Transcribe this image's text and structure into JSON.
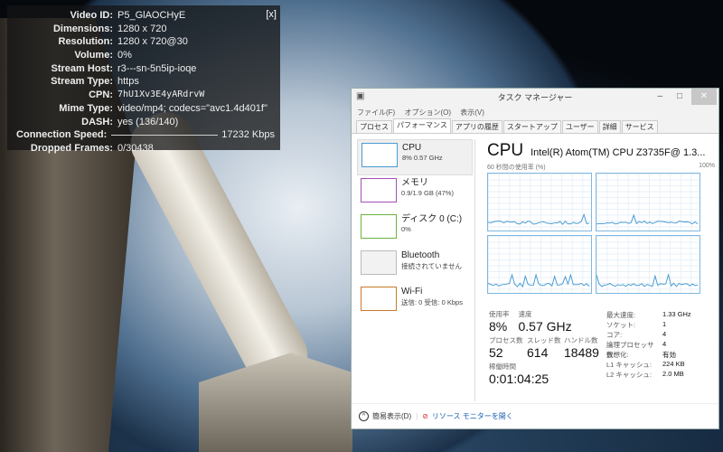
{
  "stats": {
    "close": "[x]",
    "rows": [
      {
        "k": "Video ID:",
        "v": "P5_GlAOCHyE"
      },
      {
        "k": "Dimensions:",
        "v": "1280 x 720"
      },
      {
        "k": "Resolution:",
        "v": "1280 x 720@30"
      },
      {
        "k": "Volume:",
        "v": "0%"
      },
      {
        "k": "Stream Host:",
        "v": "r3---sn-5n5ip-ioqe"
      },
      {
        "k": "Stream Type:",
        "v": "https"
      },
      {
        "k": "CPN:",
        "v": "7hU1Xv3E4yARdrvW"
      },
      {
        "k": "Mime Type:",
        "v": "video/mp4; codecs=\"avc1.4d401f\""
      },
      {
        "k": "DASH:",
        "v": "yes (136/140)"
      },
      {
        "k": "Connection Speed:",
        "v": "17232 Kbps"
      },
      {
        "k": "Dropped Frames:",
        "v": "0/30438"
      }
    ]
  },
  "tm": {
    "title": "タスク マネージャー",
    "menu": [
      "ファイル(F)",
      "オプション(O)",
      "表示(V)"
    ],
    "tabs": [
      "プロセス",
      "パフォーマンス",
      "アプリの履歴",
      "スタートアップ",
      "ユーザー",
      "詳細",
      "サービス"
    ],
    "items": [
      {
        "title": "CPU",
        "sub": "8% 0.57 GHz",
        "color": "#4a9bd1"
      },
      {
        "title": "メモリ",
        "sub": "0.9/1.9 GB (47%)",
        "color": "#a34fb5"
      },
      {
        "title": "ディスク 0 (C:)",
        "sub": "0%",
        "color": "#6db33f"
      },
      {
        "title": "Bluetooth",
        "sub": "接続されていません",
        "color": "#bbbbbb"
      },
      {
        "title": "Wi-Fi",
        "sub": "送信: 0 受信: 0 Kbps",
        "color": "#c87a2c"
      }
    ],
    "cpu_title": "CPU",
    "cpu_name": "Intel(R) Atom(TM) CPU Z3735F@ 1.3...",
    "graph_label": "60 秒間の使用率 (%)",
    "graph_max": "100%",
    "util_label": "使用率",
    "util": "8%",
    "speed_label": "速度",
    "speed": "0.57 GHz",
    "proc_label": "プロセス数",
    "proc": "52",
    "thr_label": "スレッド数",
    "thr": "614",
    "hnd_label": "ハンドル数",
    "hnd": "18489",
    "up_label": "稼働時間",
    "up": "0:01:04:25",
    "spec": [
      {
        "k": "最大速度:",
        "v": "1.33 GHz"
      },
      {
        "k": "ソケット:",
        "v": "1"
      },
      {
        "k": "コア:",
        "v": "4"
      },
      {
        "k": "論理プロセッサ数:",
        "v": "4"
      },
      {
        "k": "仮想化:",
        "v": "有効"
      },
      {
        "k": "L1 キャッシュ:",
        "v": "224 KB"
      },
      {
        "k": "L2 キャッシュ:",
        "v": "2.0 MB"
      }
    ],
    "fewer": "簡易表示(D)",
    "monitor": "リソース モニターを開く"
  }
}
